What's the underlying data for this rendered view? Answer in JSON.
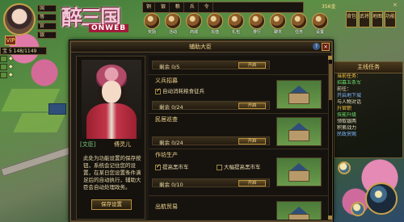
{
  "header": {
    "logo_title": "醉三国",
    "logo_sub": "ONWEB",
    "stats": [
      "国",
      "等",
      "官",
      "银",
      "粮"
    ],
    "vip_label": "VIP",
    "level_line": "宝 5 148/1149",
    "resources": [
      "铜",
      "银",
      "粮",
      "兵",
      "令"
    ],
    "coin": "356金",
    "close_label": "×",
    "top_icons": [
      "奖励",
      "活动",
      "商城",
      "充值",
      "礼包",
      "排行",
      "聊天",
      "任务",
      "设置"
    ],
    "side_menu": [
      "背包",
      "武将",
      "地图",
      "功能"
    ]
  },
  "left_status": [
    "◆",
    "◆",
    "◆"
  ],
  "task_panel": {
    "header": "主线任务",
    "lines": [
      {
        "text": "当前任务：",
        "style": "gold"
      },
      {
        "text": "招募五条军",
        "style": "green"
      },
      {
        "text": "前往：",
        "style": ""
      },
      {
        "text": "开启地下城",
        "style": "blue"
      },
      {
        "text": "与人物对话",
        "style": ""
      },
      {
        "text": "升官职",
        "style": "gold"
      },
      {
        "text": "技能升级",
        "style": "green"
      },
      {
        "text": "领取银两",
        "style": ""
      },
      {
        "text": "积累战力",
        "style": ""
      },
      {
        "text": "民政赏赐",
        "style": "blue"
      }
    ]
  },
  "dialog": {
    "title": "辅助大臣",
    "help": "?",
    "close": "×",
    "advisor": {
      "tag": "[文臣]",
      "name": "傅灵儿",
      "description": "此处为功能设置的保存按钮，系统会记住您的设置，在某日您设置条件满足后的自动执行，辅助大臣会自动处理政务。",
      "save_label": "保存设置"
    },
    "tasks": [
      {
        "name": "",
        "option": "",
        "option_checked": false,
        "remaining": "剩余 0/5",
        "button": "开启"
      },
      {
        "name": "义兵招募",
        "option": "自动消耗粮食征兵",
        "option_checked": true,
        "remaining": "剩余 0/24",
        "button": "开启"
      },
      {
        "name": "民居巡查",
        "option": "",
        "option_checked": false,
        "remaining": "剩余 0/24",
        "button": "开启"
      },
      {
        "name": "作坊生产",
        "option": "提高黑市车",
        "option_checked": true,
        "option2": "大幅提高黑市车",
        "option2_checked": false,
        "remaining": "剩余 0/10",
        "button": "开启"
      },
      {
        "name": "出航贸易",
        "option": "",
        "option_checked": false,
        "remaining": "",
        "button": ""
      }
    ]
  }
}
